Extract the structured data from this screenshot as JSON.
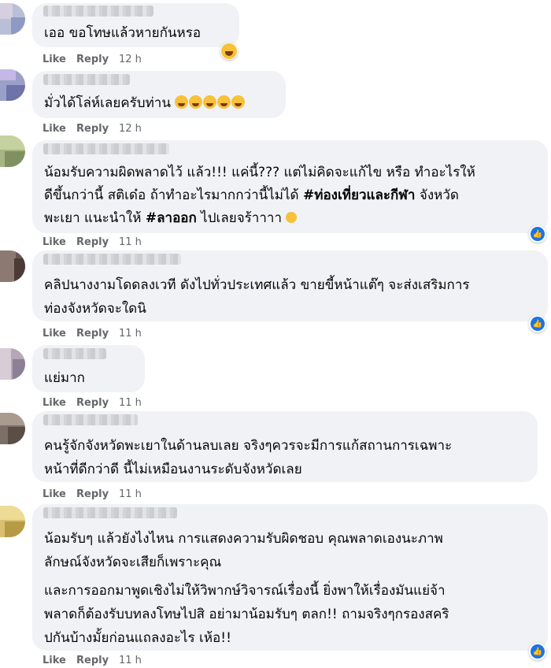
{
  "actions": {
    "like": "Like",
    "reply": "Reply"
  },
  "colors": {
    "bubble": "#f0f2f5",
    "action": "#65676b",
    "like_blue": "#1b74e4"
  },
  "comments": [
    {
      "lines": [
        "เออ ขอโทษแล้วหายกันหรอ"
      ],
      "time": "12 h",
      "reaction": "haha-icon"
    },
    {
      "lines": [
        "มั่วได้โล่ห์เลยครับท่าน"
      ],
      "emoji": "rofl-emoji x5",
      "time": "12 h"
    },
    {
      "lines": [
        "น้อมรับความผิดพลาดไว้ แล้ว!!! แค่นี้??? แต่ไม่คิดจะแก้ไข หรือ ทำอะไรให้",
        "ดีขึ้นกว่านี้ สติเด๋อ ถ้าทำอะไรมากกว่านี้ไม่ได้ ",
        "พะเยา แนะนำให้ "
      ],
      "tags": {
        "tag1": "#ท่องเที่ยวและกีฬา",
        "after1": " จังหวัด",
        "tag2": "#ลาออก",
        "after2": " ไปเลยจร้าาาา"
      },
      "time": "11 h",
      "reaction": "like-icon"
    },
    {
      "lines": [
        "คลิปนางงามโดดลงเวที ดังไปทั่วประเทศแล้ว ขายขี้หน้าแต๊ๆ จะส่งเสริมการ",
        "ท่องจังหวัดจะใดนิ"
      ],
      "time": "11 h",
      "reaction": "like-icon"
    },
    {
      "lines": [
        "แย่มาก"
      ],
      "time": "11 h"
    },
    {
      "lines": [
        "คนรู้จักจังหวัดพะเยาในด้านลบเลย จริงๆควรจะมีการแก้สถานการเฉพาะ",
        "หน้าที่ดีกว่าดี นี้ไม่เหมือนงานระดับจังหวัดเลย"
      ],
      "time": "11 h"
    },
    {
      "lines": [
        "น้อมรับๆ แล้วยังไงไหน การแสดงความรับผิดชอบ คุณพลาดเองนะภาพ",
        "ลักษณ์จังหวัดจะเสียก็เพราะคุณ",
        "และการออกมาพูดเชิงไม่ให้วิพากษ์วิจารณ์เรื่องนี้ ยิ่งพาให้เรื่องมันแย่จ้า",
        "พลาดก็ต้องรับบทลงโทษไปสิ อย่ามาน้อมรับๆ ตลก!! ถามจริงๆกรองสคริ",
        "ปกันบ้างมั้ยก่อนแถลงอะไร เห้อ!!"
      ],
      "time": "11 h",
      "reaction": "like-icon"
    }
  ]
}
